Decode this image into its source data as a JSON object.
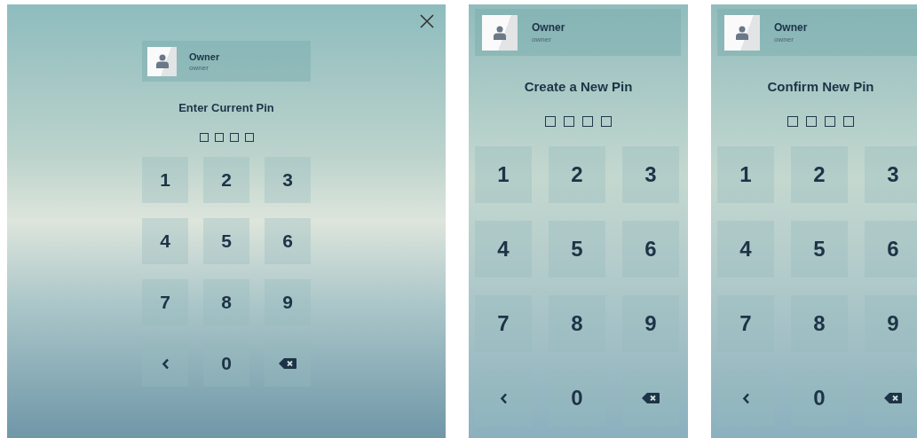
{
  "panels": [
    {
      "closable": true,
      "user": {
        "name": "Owner",
        "subtitle": "owner"
      },
      "title": "Enter Current Pin",
      "pins": [
        {
          "filled": false
        },
        {
          "filled": false
        },
        {
          "filled": false
        },
        {
          "filled": false
        }
      ],
      "keys": [
        {
          "kind": "digit",
          "label": "1"
        },
        {
          "kind": "digit",
          "label": "2"
        },
        {
          "kind": "digit",
          "label": "3"
        },
        {
          "kind": "digit",
          "label": "4"
        },
        {
          "kind": "digit",
          "label": "5"
        },
        {
          "kind": "digit",
          "label": "6"
        },
        {
          "kind": "digit",
          "label": "7"
        },
        {
          "kind": "digit",
          "label": "8"
        },
        {
          "kind": "digit",
          "label": "9"
        },
        {
          "kind": "back"
        },
        {
          "kind": "digit",
          "label": "0"
        },
        {
          "kind": "delete"
        }
      ]
    },
    {
      "closable": false,
      "user": {
        "name": "Owner",
        "subtitle": "owner"
      },
      "title": "Create a New Pin",
      "pins": [
        {
          "filled": false
        },
        {
          "filled": false
        },
        {
          "filled": false
        },
        {
          "filled": false
        }
      ],
      "keys": [
        {
          "kind": "digit",
          "label": "1"
        },
        {
          "kind": "digit",
          "label": "2"
        },
        {
          "kind": "digit",
          "label": "3"
        },
        {
          "kind": "digit",
          "label": "4"
        },
        {
          "kind": "digit",
          "label": "5"
        },
        {
          "kind": "digit",
          "label": "6"
        },
        {
          "kind": "digit",
          "label": "7"
        },
        {
          "kind": "digit",
          "label": "8"
        },
        {
          "kind": "digit",
          "label": "9"
        },
        {
          "kind": "back"
        },
        {
          "kind": "digit",
          "label": "0"
        },
        {
          "kind": "delete"
        }
      ]
    },
    {
      "closable": false,
      "user": {
        "name": "Owner",
        "subtitle": "owner"
      },
      "title": "Confirm New Pin",
      "pins": [
        {
          "filled": false
        },
        {
          "filled": false
        },
        {
          "filled": false
        },
        {
          "filled": false
        }
      ],
      "keys": [
        {
          "kind": "digit",
          "label": "1"
        },
        {
          "kind": "digit",
          "label": "2"
        },
        {
          "kind": "digit",
          "label": "3"
        },
        {
          "kind": "digit",
          "label": "4"
        },
        {
          "kind": "digit",
          "label": "5"
        },
        {
          "kind": "digit",
          "label": "6"
        },
        {
          "kind": "digit",
          "label": "7"
        },
        {
          "kind": "digit",
          "label": "8"
        },
        {
          "kind": "digit",
          "label": "9"
        },
        {
          "kind": "back"
        },
        {
          "kind": "digit",
          "label": "0"
        },
        {
          "kind": "delete"
        }
      ]
    }
  ]
}
